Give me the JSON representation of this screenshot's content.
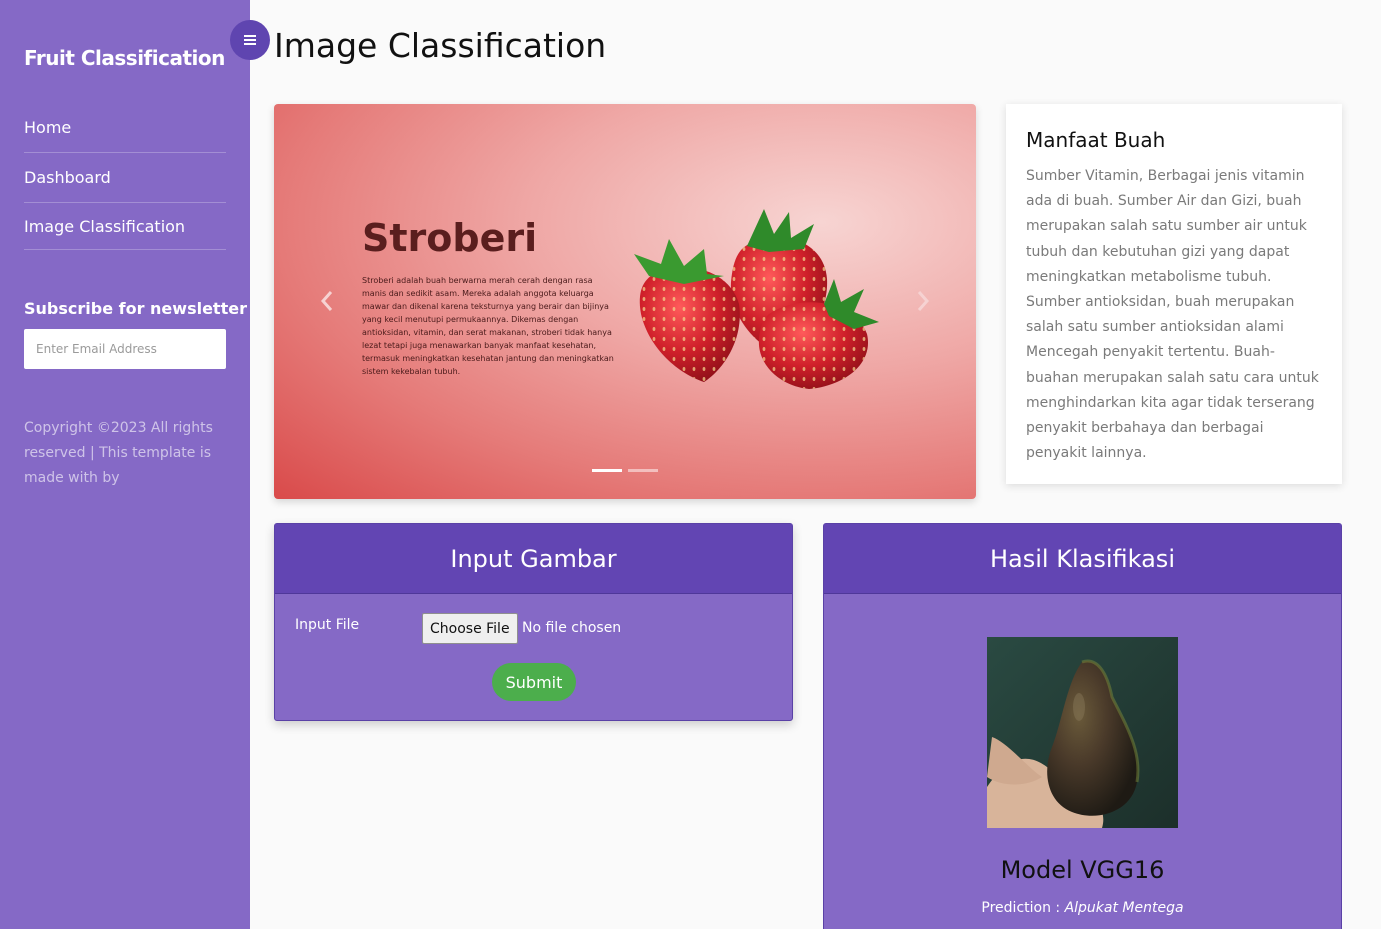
{
  "sidebar": {
    "brand": "Fruit Classification",
    "toggle_icon": "menu-icon",
    "nav": [
      {
        "label": "Home"
      },
      {
        "label": "Dashboard"
      },
      {
        "label": "Image Classification"
      }
    ],
    "newsletter_title": "Subscribe for newsletter",
    "email_placeholder": "Enter Email Address",
    "copyright": "Copyright ©2023 All rights reserved | This template is made with by"
  },
  "page": {
    "title": "Image Classification"
  },
  "carousel": {
    "slide_title": "Stroberi",
    "slide_text": "Stroberi adalah buah berwarna merah cerah dengan rasa manis dan sedikit asam. Mereka adalah anggota keluarga mawar dan dikenal karena teksturnya yang berair dan bijinya yang kecil menutupi permukaannya. Dikemas dengan antioksidan, vitamin, dan serat makanan, stroberi tidak hanya lezat tetapi juga menawarkan banyak manfaat kesehatan, termasuk meningkatkan kesehatan jantung dan meningkatkan sistem kekebalan tubuh.",
    "prev_icon": "chevron-left-icon",
    "next_icon": "chevron-right-icon",
    "active_slide": 1,
    "slide_count": 2
  },
  "info": {
    "title": "Manfaat Buah",
    "text": "Sumber Vitamin, Berbagai jenis vitamin ada di buah. Sumber Air dan Gizi, buah merupakan salah satu sumber air untuk tubuh dan kebutuhan gizi yang dapat meningkatkan metabolisme tubuh. Sumber antioksidan, buah merupakan salah satu sumber antioksidan alami Mencegah penyakit tertentu. Buah-buahan merupakan salah satu cara untuk menghindarkan kita agar tidak terserang penyakit berbahaya dan berbagai penyakit lainnya."
  },
  "input_panel": {
    "title": "Input Gambar",
    "file_label": "Input File",
    "choose_button": "Choose File",
    "file_status": "No file chosen",
    "submit": "Submit"
  },
  "result_panel": {
    "title": "Hasil Klasifikasi",
    "model": "Model VGG16",
    "prediction_label": "Prediction :",
    "prediction_value": "Alpukat Mentega"
  },
  "colors": {
    "sidebar": "#8569c6",
    "panel_header": "#6245b3",
    "toggle": "#5f45b0",
    "submit": "#4cae4c"
  }
}
